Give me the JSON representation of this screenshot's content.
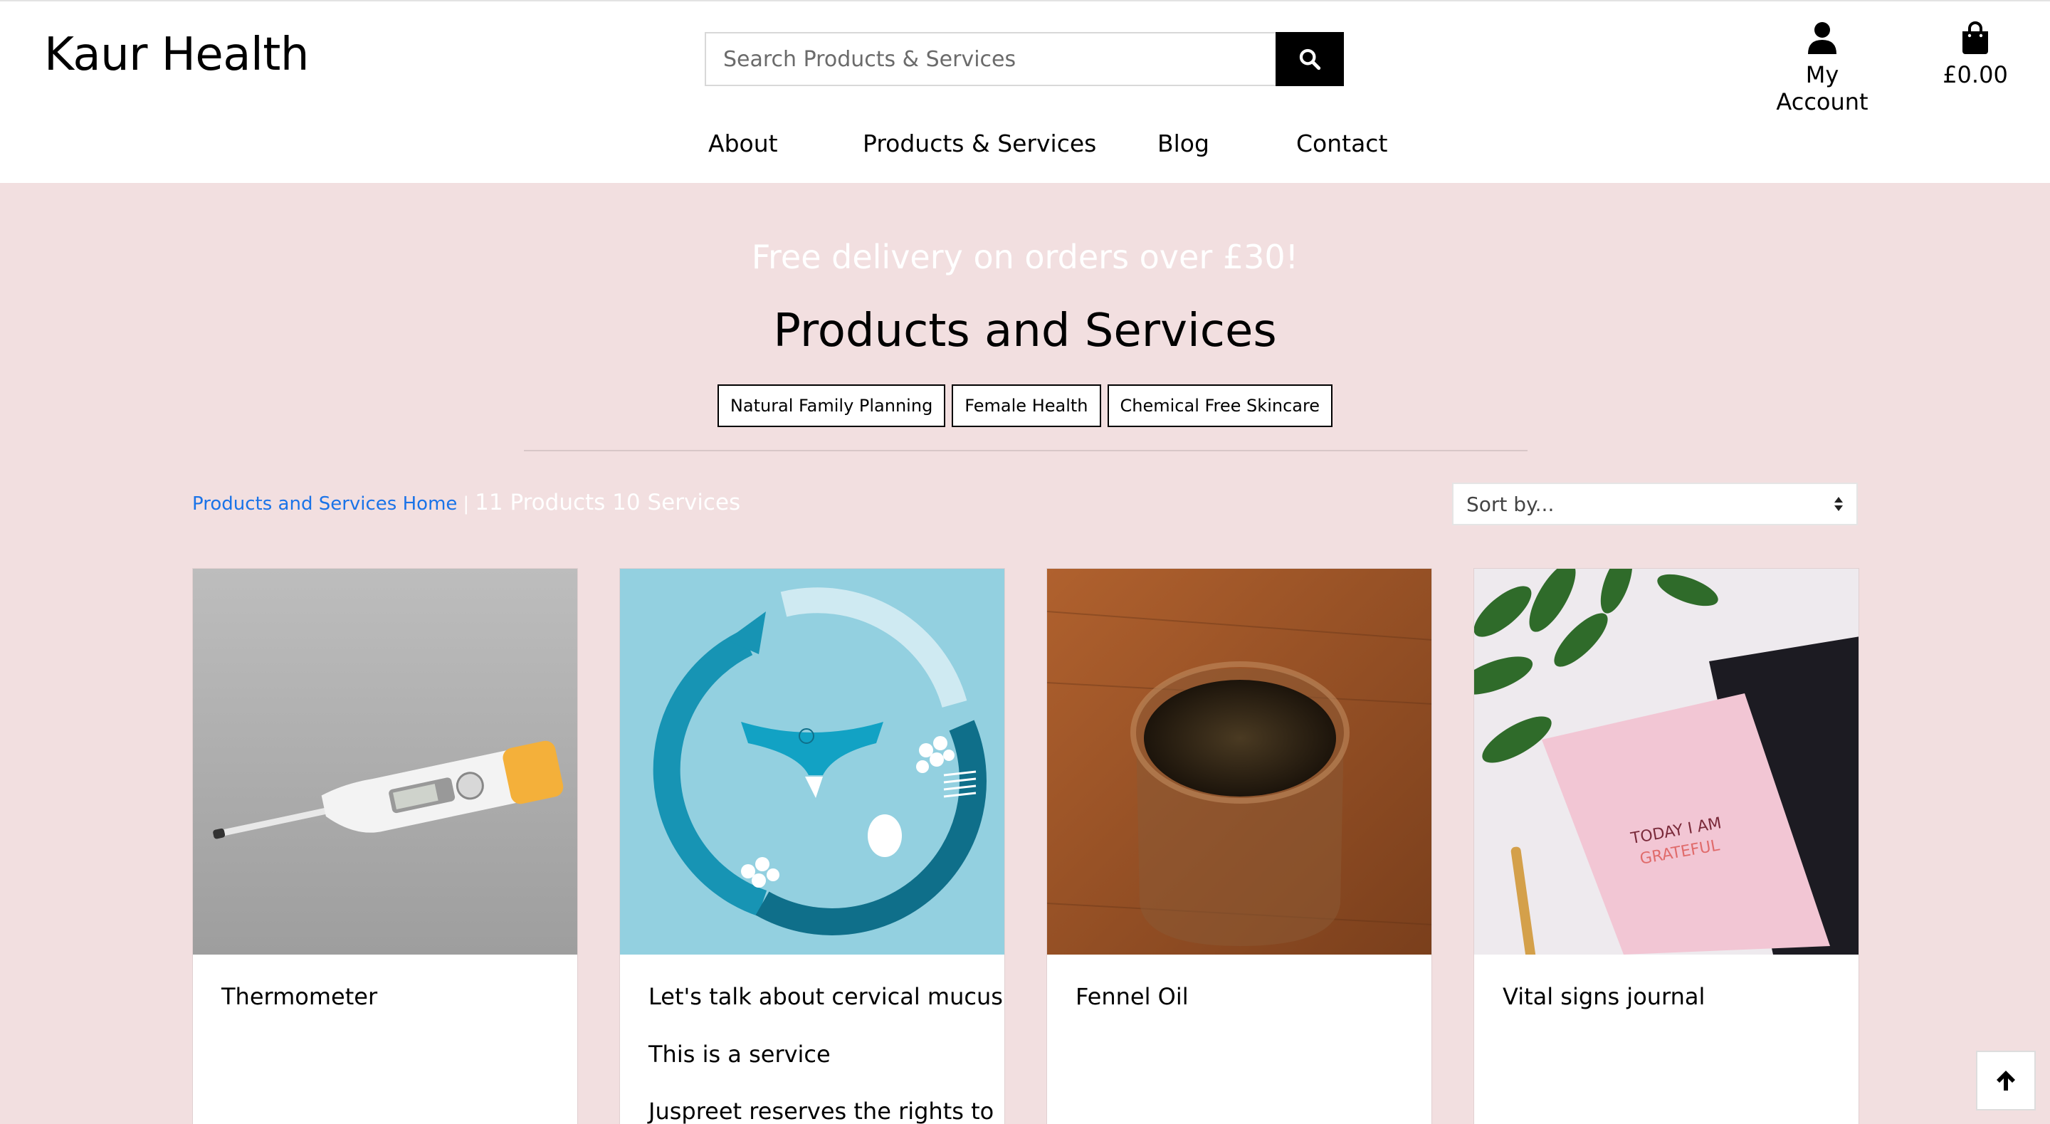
{
  "brand": {
    "name": "Kaur Health"
  },
  "search": {
    "placeholder": "Search Products & Services",
    "icon": "search-icon"
  },
  "account": {
    "label": "My Account",
    "icon": "user-icon"
  },
  "bag": {
    "total": "£0.00",
    "icon": "shopping-bag-icon"
  },
  "nav": {
    "items": [
      "About",
      "Products & Services",
      "Blog",
      "Contact"
    ]
  },
  "banner": {
    "text": "Free delivery on orders over £30!"
  },
  "page": {
    "title": "Products and Services"
  },
  "filters": [
    "Natural Family Planning",
    "Female Health",
    "Chemical Free Skincare"
  ],
  "breadcrumb": {
    "home": "Products and Services Home",
    "separator": "|",
    "count": "11 Products 10 Services"
  },
  "sort": {
    "selected": "Sort by..."
  },
  "products": [
    {
      "name": "Thermometer",
      "image": "digital-thermometer-photo"
    },
    {
      "name": "Let's talk about cervical mucus",
      "description": "This is a service",
      "description_more": "Juspreet reserves the rights to",
      "image": "menstrual-cycle-illustration"
    },
    {
      "name": "Fennel Oil",
      "image": "jar-of-seeds-photo"
    },
    {
      "name": "Vital signs journal",
      "image": "pink-journal-photo",
      "image_text": "TODAY I AM GRATEFUL"
    }
  ],
  "back_to_top": {
    "icon": "arrow-up-icon"
  },
  "colors": {
    "page_bg": "#f2dfe0",
    "header_bg": "#ffffff",
    "link": "#1a73e8",
    "button_dark": "#000000"
  }
}
